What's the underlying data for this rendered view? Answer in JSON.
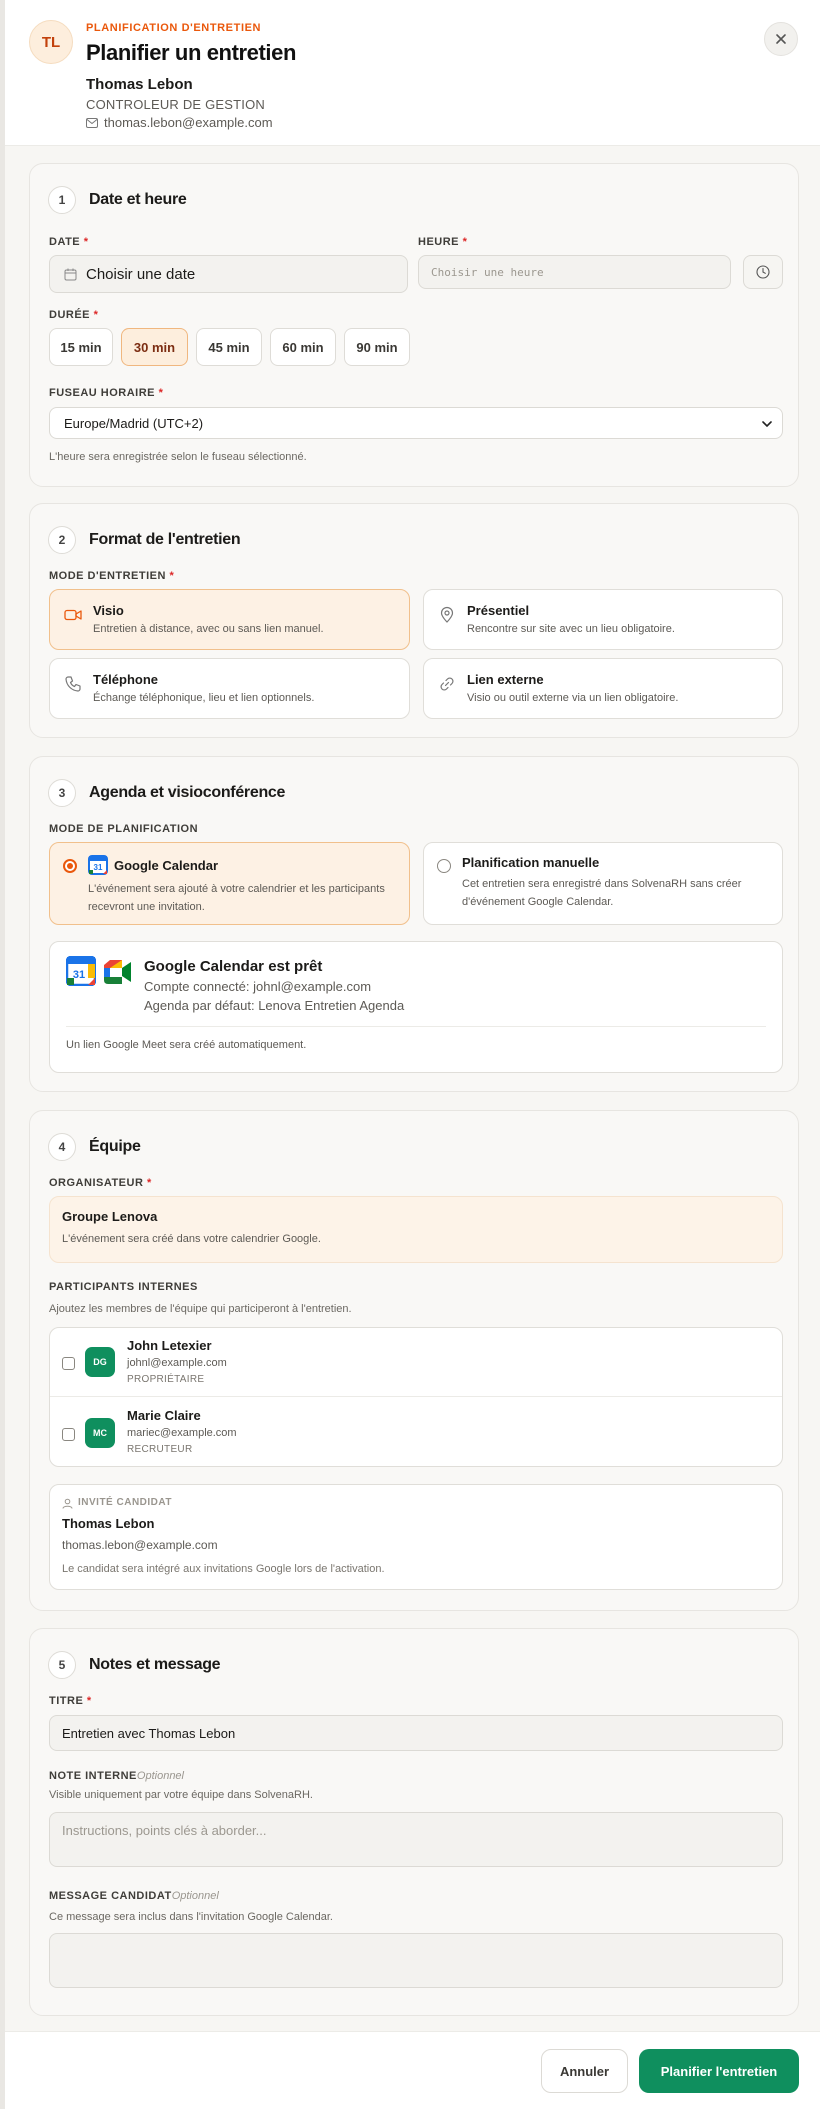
{
  "header": {
    "initials": "TL",
    "eyebrow": "PLANIFICATION D'ENTRETIEN",
    "title": "Planifier un entretien",
    "candidate_name": "Thomas Lebon",
    "candidate_role": "CONTROLEUR DE GESTION",
    "candidate_email": "thomas.lebon@example.com"
  },
  "s1": {
    "num": "1",
    "title": "Date et heure",
    "date_label": "DATE",
    "date_value": "Choisir une date",
    "time_label": "HEURE",
    "time_placeholder": "Choisir une heure",
    "duration_label": "DURÉE",
    "durations": [
      "15 min",
      "30 min",
      "45 min",
      "60 min",
      "90 min"
    ],
    "duration_selected_index": 1,
    "tz_label": "FUSEAU HORAIRE",
    "tz_value": "Europe/Madrid (UTC+2)",
    "tz_hint": "L'heure sera enregistrée selon le fuseau sélectionné."
  },
  "s2": {
    "num": "2",
    "title": "Format de l'entretien",
    "mode_label": "MODE D'ENTRETIEN",
    "modes": [
      {
        "title": "Visio",
        "desc": "Entretien à distance, avec ou sans lien manuel.",
        "icon": "video-icon"
      },
      {
        "title": "Présentiel",
        "desc": "Rencontre sur site avec un lieu obligatoire.",
        "icon": "map-pin-icon"
      },
      {
        "title": "Téléphone",
        "desc": "Échange téléphonique, lieu et lien optionnels.",
        "icon": "phone-icon"
      },
      {
        "title": "Lien externe",
        "desc": "Visio ou outil externe via un lien obligatoire.",
        "icon": "link-icon"
      }
    ]
  },
  "s3": {
    "num": "3",
    "title": "Agenda et visioconférence",
    "plan_label": "MODE DE PLANIFICATION",
    "gcal_title": "Google Calendar",
    "gcal_desc1": "L'événement sera ajouté à votre calendrier et les participants",
    "gcal_desc2": "recevront une invitation.",
    "manual_title": "Planification manuelle",
    "manual_desc1": "Cet entretien sera enregistré dans SolvenaRH sans créer",
    "manual_desc2": "d'événement Google Calendar.",
    "ready_title": "Google Calendar est prêt",
    "ready_account": "Compte connecté: johnl@example.com",
    "ready_agenda": "Agenda par défaut: Lenova Entretien Agenda",
    "calendar_date": "31",
    "ready_note": "Un lien Google Meet sera créé automatiquement."
  },
  "s4": {
    "num": "4",
    "title": "Équipe",
    "org_label": "ORGANISATEUR",
    "org_name": "Groupe Lenova",
    "org_desc": "L'événement sera créé dans votre calendrier Google.",
    "part_label": "PARTICIPANTS INTERNES",
    "part_hint": "Ajoutez les membres de l'équipe qui participeront à l'entretien.",
    "participants": [
      {
        "initials": "DG",
        "name": "John Letexier",
        "email": "johnl@example.com",
        "role": "PROPRIÉTAIRE"
      },
      {
        "initials": "MC",
        "name": "Marie Claire",
        "email": "mariec@example.com",
        "role": "RECRUTEUR"
      }
    ],
    "guest_label": "INVITÉ CANDIDAT",
    "guest_name": "Thomas Lebon",
    "guest_email": "thomas.lebon@example.com",
    "guest_hint": "Le candidat sera intégré aux invitations Google lors de l'activation."
  },
  "s5": {
    "num": "5",
    "title": "Notes et message",
    "title_label": "TITRE",
    "title_value": "Entretien avec Thomas Lebon",
    "note_label": "NOTE INTERNE",
    "optional": "Optionnel",
    "note_hint": "Visible uniquement par votre équipe dans SolvenaRH.",
    "note_placeholder": "Instructions, points clés à aborder...",
    "msg_label": "MESSAGE CANDIDAT",
    "msg_hint": "Ce message sera inclus dans l'invitation Google Calendar."
  },
  "footer": {
    "cancel": "Annuler",
    "submit": "Planifier l'entretien"
  },
  "colors": {
    "accent": "#ea580c",
    "primary": "#0f8f5e",
    "selected_bg": "#fdeedd"
  }
}
